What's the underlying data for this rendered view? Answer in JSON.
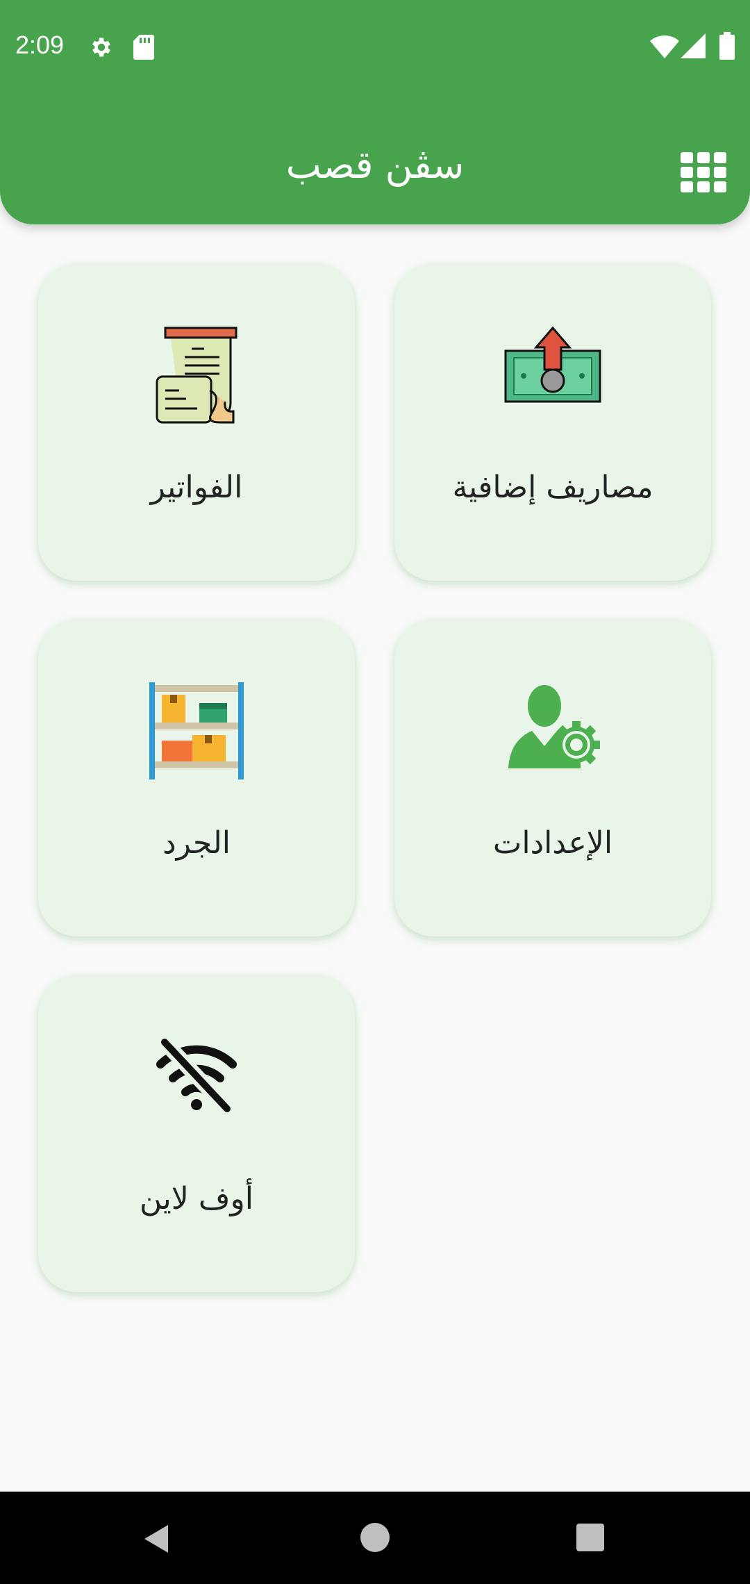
{
  "status_bar": {
    "time": "2:09",
    "left_icons": [
      "settings-gear-icon",
      "sd-card-icon"
    ],
    "right_icons": [
      "wifi-icon",
      "signal-icon",
      "battery-icon"
    ]
  },
  "header": {
    "title": "سڤن قصب",
    "menu_icon": "grid-menu-icon",
    "color": "#47a34c"
  },
  "cards": [
    {
      "label": "مصاريف إضافية",
      "icon": "money-expense-icon"
    },
    {
      "label": "الفواتير",
      "icon": "invoice-receipt-icon"
    },
    {
      "label": "الإعدادات",
      "icon": "user-settings-icon"
    },
    {
      "label": "الجرد",
      "icon": "inventory-shelf-icon"
    },
    {
      "label": "أوف لاين",
      "icon": "wifi-off-icon"
    }
  ],
  "nav_bar": {
    "buttons": [
      "back-icon",
      "home-icon",
      "recents-icon"
    ]
  },
  "colors": {
    "primary": "#47a34c",
    "card_bg": "#e8f5e8",
    "page_bg": "#f9f9f9"
  }
}
